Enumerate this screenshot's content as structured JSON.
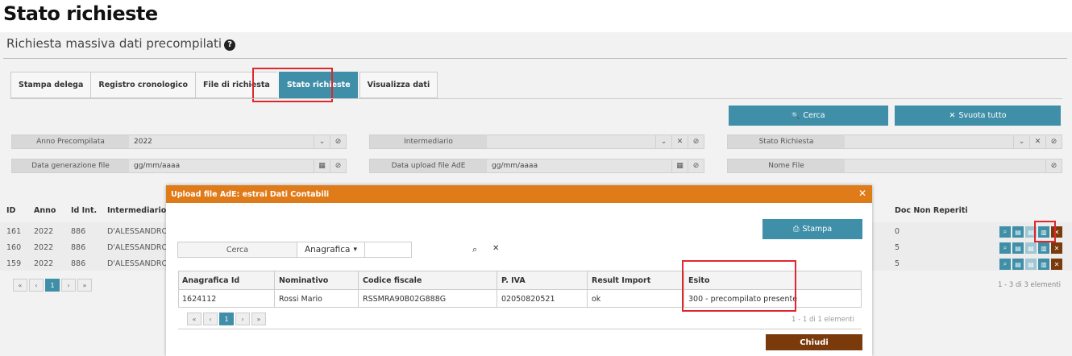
{
  "page_title": "Stato richieste",
  "subtitle": "Richiesta massiva dati precompilati",
  "help_icon": "?",
  "tabs": [
    "Stampa delega",
    "Registro cronologico",
    "File di richiesta",
    "Stato richieste",
    "Visualizza dati"
  ],
  "buttons": {
    "search": "Cerca",
    "clear": "Svuota tutto",
    "search_icon": "🔍",
    "clear_icon": "✕"
  },
  "filters": {
    "anno_label": "Anno Precompilata",
    "anno_value": "2022",
    "intermediario_label": "Intermediario",
    "stato_label": "Stato Richiesta",
    "data_gen_label": "Data generazione file",
    "data_gen_placeholder": "gg/mm/aaaa",
    "data_upload_label": "Data upload file AdE",
    "data_upload_placeholder": "gg/mm/aaaa",
    "nome_file_label": "Nome File"
  },
  "bg_table": {
    "headers": [
      "ID",
      "Anno",
      "Id Int.",
      "Intermediario",
      "Doc Non Reperiti"
    ],
    "rows": [
      {
        "id": "161",
        "anno": "2022",
        "idint": "886",
        "inter": "D'ALESSANDRO",
        "doc": "0"
      },
      {
        "id": "160",
        "anno": "2022",
        "idint": "886",
        "inter": "D'ALESSANDRO",
        "doc": "5"
      },
      {
        "id": "159",
        "anno": "2022",
        "idint": "886",
        "inter": "D'ALESSANDRO",
        "doc": "5"
      }
    ],
    "pager": [
      "«",
      "‹",
      "1",
      "›",
      "»"
    ],
    "count": "1 - 3 di 3 elementi"
  },
  "modal": {
    "title": "Upload file AdE: estrai Dati Contabili",
    "close": "✕",
    "print_label": "Stampa",
    "search_label": "Cerca",
    "search_field": "Anagrafica",
    "columns": [
      "Anagrafica Id",
      "Nominativo",
      "Codice fiscale",
      "P. IVA",
      "Result Import",
      "Esito"
    ],
    "row": {
      "id": "1624112",
      "nome": "Rossi Mario",
      "cf": "RSSMRA90B02G888G",
      "piva": "02050820521",
      "result": "ok",
      "esito": "300 - precompilato presente"
    },
    "pager": [
      "«",
      "‹",
      "1",
      "›",
      "»"
    ],
    "count": "1 - 1 di 1 elementi",
    "chiudi": "Chiudi"
  },
  "colors": {
    "teal": "#3f8fa8",
    "orange": "#e07b1a",
    "brown": "#7a3a0c",
    "highlight": "#e0262e"
  }
}
